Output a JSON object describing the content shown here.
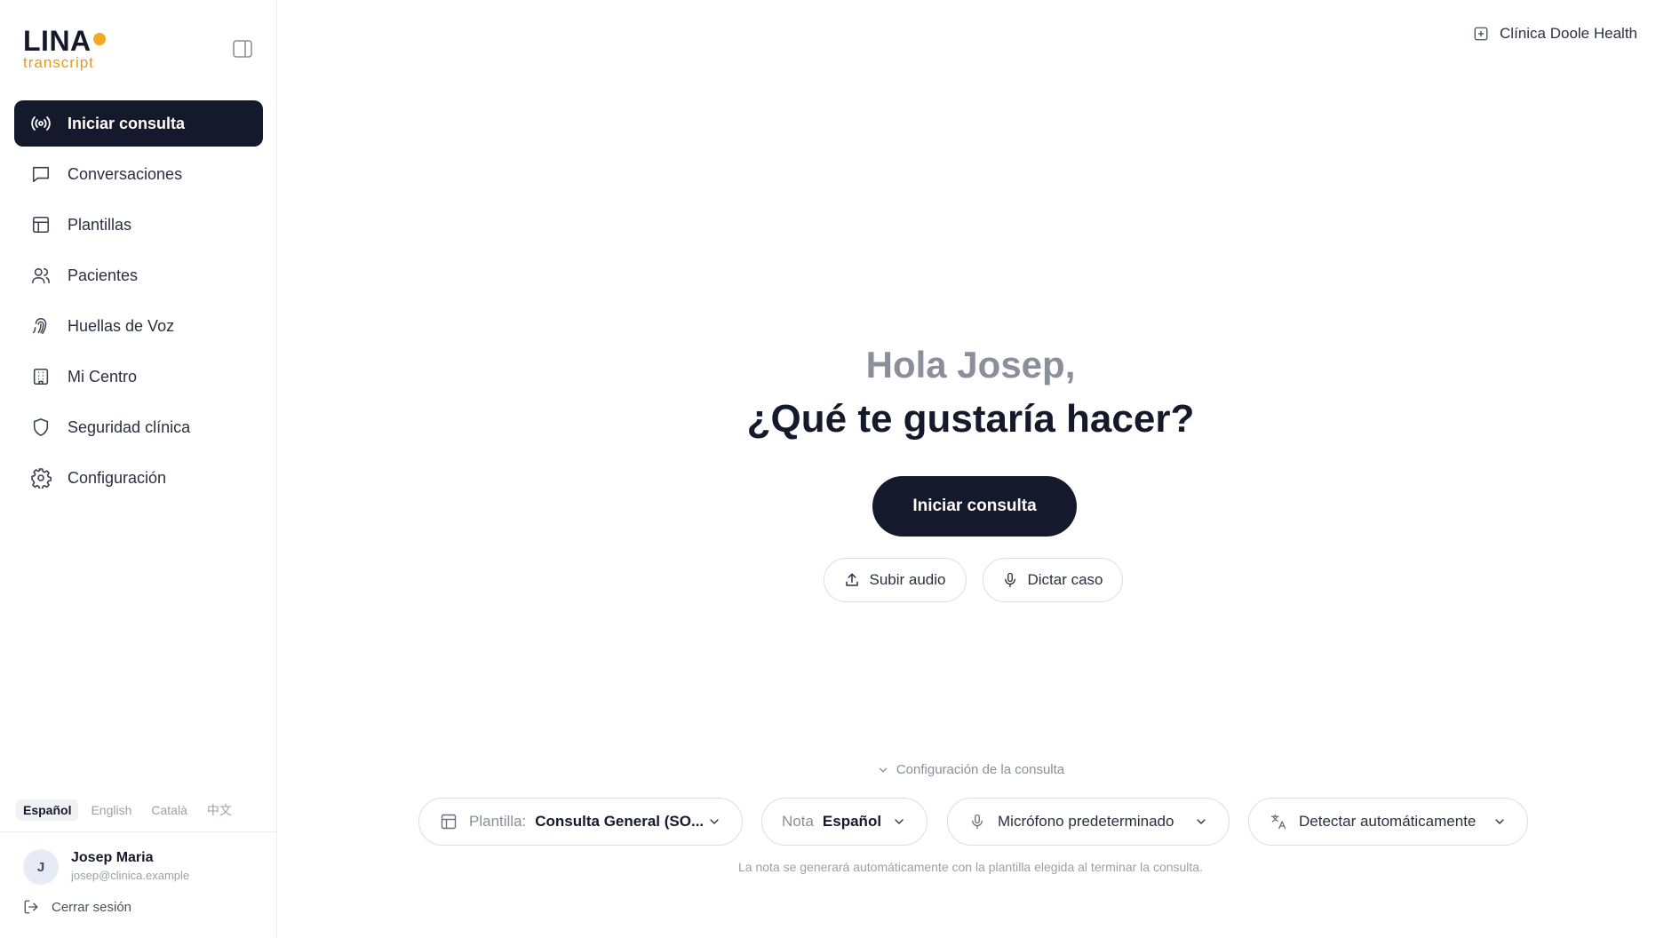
{
  "logo": {
    "name": "LINA",
    "sub": "transcript"
  },
  "sidebar": {
    "items": [
      {
        "label": "Iniciar consulta",
        "icon": "broadcast-icon",
        "active": true
      },
      {
        "label": "Conversaciones",
        "icon": "message-icon"
      },
      {
        "label": "Plantillas",
        "icon": "template-icon"
      },
      {
        "label": "Pacientes",
        "icon": "users-icon"
      },
      {
        "label": "Huellas de Voz",
        "icon": "fingerprint-icon"
      },
      {
        "label": "Mi Centro",
        "icon": "building-icon"
      },
      {
        "label": "Seguridad clínica",
        "icon": "shield-icon"
      },
      {
        "label": "Configuración",
        "icon": "gear-icon"
      }
    ],
    "languages": [
      "Español",
      "English",
      "Català",
      "中文"
    ],
    "active_language": "Español"
  },
  "user": {
    "initial": "J",
    "name": "Josep Maria",
    "email": "josep@clinica.example",
    "logout_label": "Cerrar sesión"
  },
  "header": {
    "clinic": "Clínica Doole Health"
  },
  "main": {
    "greeting": "Hola Josep,",
    "question": "¿Qué te gustaría hacer?",
    "start_button": "Iniciar consulta",
    "upload_button": "Subir audio",
    "dictate_button": "Dictar caso",
    "config_toggle": "Configuración de la consulta",
    "template_prefix": "Plantilla:",
    "template_value": "Consulta General (SO...",
    "nota_prefix": "Nota",
    "nota_value": "Español",
    "mic_value": "Micrófono predeterminado",
    "lang_detect_value": "Detectar automáticamente",
    "hint": "La nota se generará automáticamente con la plantilla elegida al terminar la consulta."
  },
  "colors": {
    "primary": "#141a2b",
    "accent": "#f2a81f",
    "muted": "#8a8f99"
  }
}
